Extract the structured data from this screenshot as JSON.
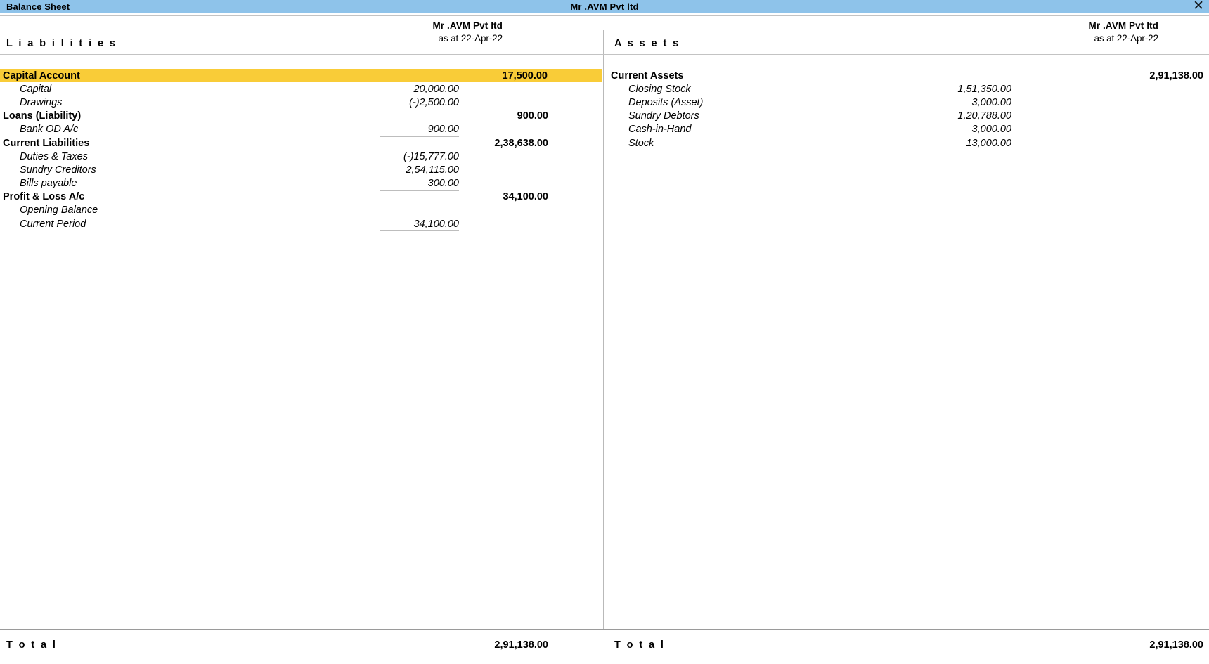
{
  "titlebar": {
    "report_name": "Balance Sheet",
    "company_name": "Mr .AVM  Pvt ltd",
    "close_icon": "close-icon",
    "close_glyph": "✕",
    "bar_color": "#8ec3ea"
  },
  "theme": {
    "highlight_color": "#f9cc38",
    "rule_color": "#bdbdbd",
    "text_color": "#000000"
  },
  "liabilities": {
    "heading": "L i a b i l i t i e s",
    "company": "Mr .AVM  Pvt ltd",
    "as_at": "as at 22-Apr-22",
    "rows": [
      {
        "label": "Capital Account",
        "total": "17,500.00",
        "amount": "",
        "kind": "group",
        "italic": false,
        "highlight": true,
        "ruled": false
      },
      {
        "label": "Capital",
        "total": "",
        "amount": "20,000.00",
        "kind": "item",
        "italic": true,
        "highlight": false,
        "ruled": false
      },
      {
        "label": "Drawings",
        "total": "",
        "amount": "(-)2,500.00",
        "kind": "item",
        "italic": true,
        "highlight": false,
        "ruled": true
      },
      {
        "label": "Loans (Liability)",
        "total": "900.00",
        "amount": "",
        "kind": "group",
        "italic": false,
        "highlight": false,
        "ruled": false
      },
      {
        "label": "Bank OD A/c",
        "total": "",
        "amount": "900.00",
        "kind": "item",
        "italic": true,
        "highlight": false,
        "ruled": true
      },
      {
        "label": "Current Liabilities",
        "total": "2,38,638.00",
        "amount": "",
        "kind": "group",
        "italic": false,
        "highlight": false,
        "ruled": false
      },
      {
        "label": "Duties & Taxes",
        "total": "",
        "amount": "(-)15,777.00",
        "kind": "item",
        "italic": true,
        "highlight": false,
        "ruled": false
      },
      {
        "label": "Sundry Creditors",
        "total": "",
        "amount": "2,54,115.00",
        "kind": "item",
        "italic": true,
        "highlight": false,
        "ruled": false
      },
      {
        "label": "Bills payable",
        "total": "",
        "amount": "300.00",
        "kind": "item",
        "italic": true,
        "highlight": false,
        "ruled": true
      },
      {
        "label": "Profit & Loss A/c",
        "total": "34,100.00",
        "amount": "",
        "kind": "group",
        "italic": false,
        "highlight": false,
        "ruled": false
      },
      {
        "label": "Opening Balance",
        "total": "",
        "amount": "",
        "kind": "item",
        "italic": true,
        "highlight": false,
        "ruled": false
      },
      {
        "label": "Current Period",
        "total": "",
        "amount": "34,100.00",
        "kind": "item",
        "italic": true,
        "highlight": false,
        "ruled": true
      }
    ],
    "total_label": "T o t a l",
    "total_value": "2,91,138.00"
  },
  "assets": {
    "heading": "A s s e t s",
    "company": "Mr .AVM  Pvt ltd",
    "as_at": "as at 22-Apr-22",
    "rows": [
      {
        "label": "Current Assets",
        "total": "2,91,138.00",
        "amount": "",
        "kind": "group",
        "italic": false,
        "highlight": false,
        "ruled": false
      },
      {
        "label": "Closing Stock",
        "total": "",
        "amount": "1,51,350.00",
        "kind": "item",
        "italic": true,
        "highlight": false,
        "ruled": false
      },
      {
        "label": "Deposits (Asset)",
        "total": "",
        "amount": "3,000.00",
        "kind": "item",
        "italic": true,
        "highlight": false,
        "ruled": false
      },
      {
        "label": "Sundry Debtors",
        "total": "",
        "amount": "1,20,788.00",
        "kind": "item",
        "italic": true,
        "highlight": false,
        "ruled": false
      },
      {
        "label": "Cash-in-Hand",
        "total": "",
        "amount": "3,000.00",
        "kind": "item",
        "italic": true,
        "highlight": false,
        "ruled": false
      },
      {
        "label": "Stock",
        "total": "",
        "amount": "13,000.00",
        "kind": "item",
        "italic": true,
        "highlight": false,
        "ruled": true
      }
    ],
    "total_label": "T o t a l",
    "total_value": "2,91,138.00"
  }
}
